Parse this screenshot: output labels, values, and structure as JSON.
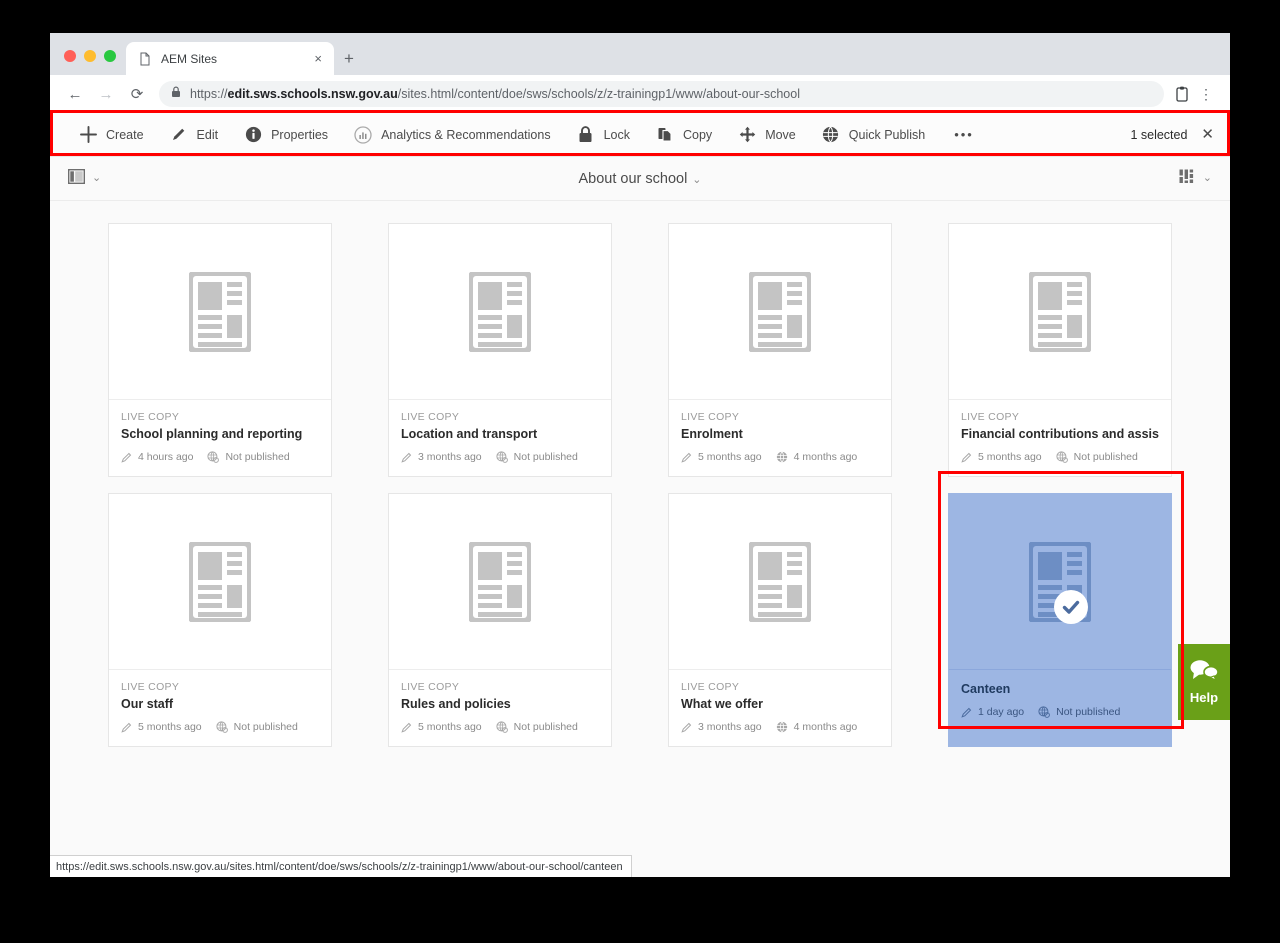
{
  "browser": {
    "tab": {
      "title": "AEM Sites",
      "favicon_icon": "page-icon",
      "close_icon": "×"
    },
    "new_tab_icon": "+",
    "nav": {
      "back_icon": "←",
      "forward_icon": "→",
      "reload_icon": "⟳",
      "lock_icon": "lock-icon",
      "url_scheme": "https://",
      "url_host": "edit.sws.schools.nsw.gov.au",
      "url_path": "/sites.html/content/doe/sws/schools/z/z-trainingp1/www/about-our-school",
      "url_full": "https://edit.sws.schools.nsw.gov.au/sites.html/content/doe/sws/schools/z/z-trainingp1/www/about-our-school",
      "profile_icon": "profile-icon",
      "menu_icon": "⋮"
    }
  },
  "toolbar": {
    "actions": [
      {
        "label": "Create",
        "icon": "plus-icon"
      },
      {
        "label": "Edit",
        "icon": "pencil-icon"
      },
      {
        "label": "Properties",
        "icon": "info-icon"
      },
      {
        "label": "Analytics & Recommendations",
        "icon": "analytics-icon"
      },
      {
        "label": "Lock",
        "icon": "lock-icon"
      },
      {
        "label": "Copy",
        "icon": "copy-icon"
      },
      {
        "label": "Move",
        "icon": "move-icon"
      },
      {
        "label": "Quick Publish",
        "icon": "globe-icon"
      }
    ],
    "more_icon": "•••",
    "selected_label": "1 selected",
    "close_icon": "✕"
  },
  "breadcrumb": {
    "rail_toggle_icon": "rail-panel-icon",
    "rail_caret": "⌄",
    "title": "About our school",
    "title_caret": "⌄",
    "view_toggle_icon": "card-view-icon",
    "view_caret": "⌄"
  },
  "cards": [
    {
      "badge": "LIVE COPY",
      "title": "School planning and reporting",
      "modified": "4 hours ago",
      "publish": "Not published",
      "publish_state": "unpublished",
      "selected": false
    },
    {
      "badge": "LIVE COPY",
      "title": "Location and transport",
      "modified": "3 months ago",
      "publish": "Not published",
      "publish_state": "unpublished",
      "selected": false
    },
    {
      "badge": "LIVE COPY",
      "title": "Enrolment",
      "modified": "5 months ago",
      "publish": "4 months ago",
      "publish_state": "published",
      "selected": false
    },
    {
      "badge": "LIVE COPY",
      "title": "Financial contributions and assistance",
      "modified": "5 months ago",
      "publish": "Not published",
      "publish_state": "unpublished",
      "selected": false
    },
    {
      "badge": "LIVE COPY",
      "title": "Our staff",
      "modified": "5 months ago",
      "publish": "Not published",
      "publish_state": "unpublished",
      "selected": false
    },
    {
      "badge": "LIVE COPY",
      "title": "Rules and policies",
      "modified": "5 months ago",
      "publish": "Not published",
      "publish_state": "unpublished",
      "selected": false
    },
    {
      "badge": "LIVE COPY",
      "title": "What we offer",
      "modified": "3 months ago",
      "publish": "4 months ago",
      "publish_state": "published",
      "selected": false
    },
    {
      "badge": "",
      "title": "Canteen",
      "modified": "1 day ago",
      "publish": "Not published",
      "publish_state": "unpublished",
      "selected": true
    }
  ],
  "help_widget": {
    "label": "Help",
    "icon": "chat-bubbles-icon",
    "color": "#6aa018"
  },
  "status_bar": {
    "url": "https://edit.sws.schools.nsw.gov.au/sites.html/content/doe/sws/schools/z/z-trainingp1/www/about-our-school/canteen"
  },
  "highlight_color": "#ff0000"
}
